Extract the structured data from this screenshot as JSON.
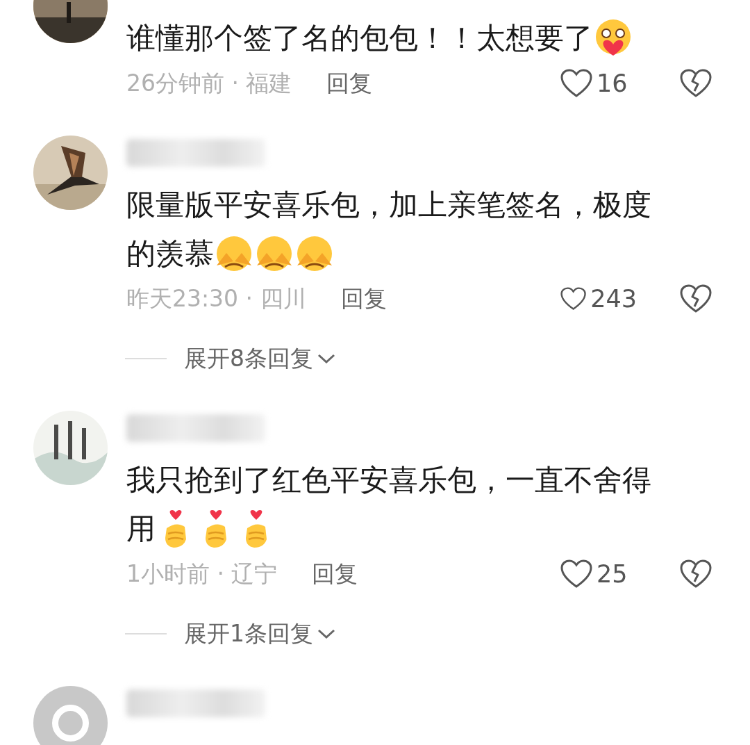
{
  "comments": [
    {
      "avatar": {
        "kind": "picture"
      },
      "lines": [
        "谁懂那个签了名的包包！！太想要了"
      ],
      "emojis": [
        {
          "kind": "heart-eyes"
        }
      ],
      "time": "26分钟前 · 福建",
      "reply": "回复",
      "likes": "16"
    },
    {
      "avatar": {
        "kind": "picture"
      },
      "lines": [
        "限量版平安喜乐包，加上亲笔签名，极度",
        "的羡慕"
      ],
      "emojis": [
        {
          "kind": "cover-face"
        },
        {
          "kind": "cover-face"
        },
        {
          "kind": "cover-face"
        }
      ],
      "time": "昨天23:30 · 四川",
      "reply": "回复",
      "likes": "243",
      "expand": "展开8条回复"
    },
    {
      "avatar": {
        "kind": "picture"
      },
      "lines": [
        "我只抢到了红色平安喜乐包，一直不舍得",
        "用"
      ],
      "emojis": [
        {
          "kind": "finger-heart"
        },
        {
          "kind": "finger-heart"
        },
        {
          "kind": "finger-heart"
        }
      ],
      "time": "1小时前 · 辽宁",
      "reply": "回复",
      "likes": "25",
      "expand": "展开1条回复"
    },
    {
      "avatar": {
        "kind": "default"
      }
    }
  ]
}
